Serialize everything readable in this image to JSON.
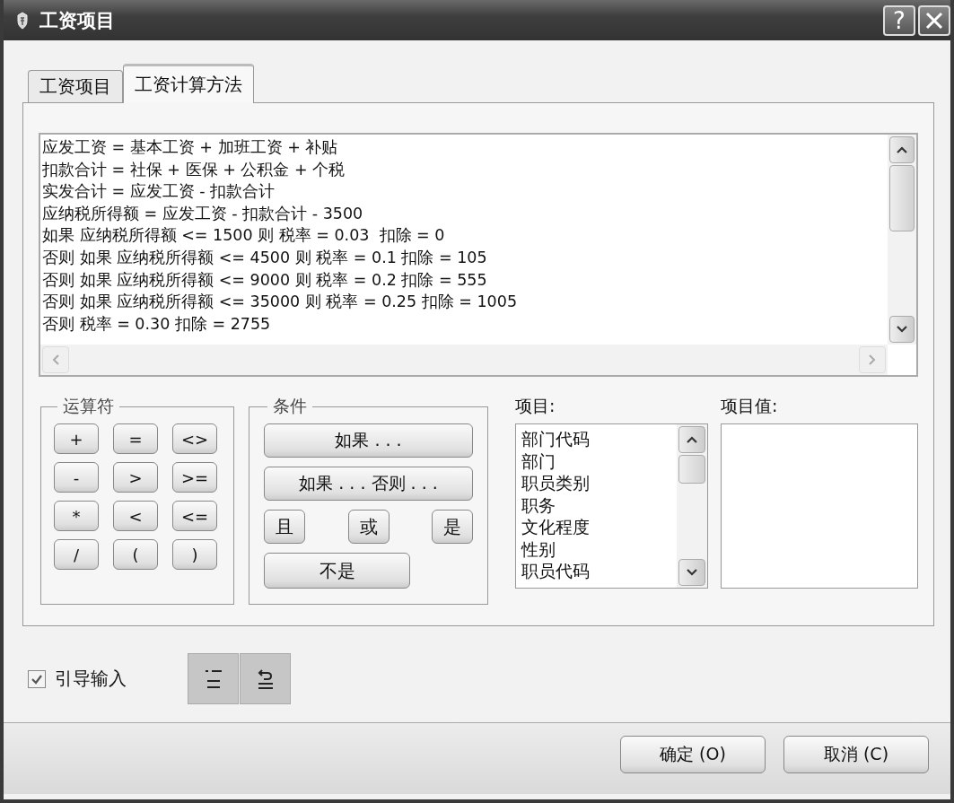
{
  "window": {
    "title": "工资项目",
    "help_button": "?"
  },
  "tabs": [
    {
      "label": "工资项目",
      "selected": false
    },
    {
      "label": "工资计算方法",
      "selected": true
    }
  ],
  "formula_lines": [
    "应发工资 = 基本工资 + 加班工资 + 补贴",
    "扣款合计 = 社保 + 医保 + 公积金 + 个税",
    "实发合计 = 应发工资 - 扣款合计",
    "应纳税所得额 = 应发工资 - 扣款合计 - 3500",
    "如果 应纳税所得额 <= 1500 则 税率 = 0.03  扣除 = 0",
    "否则 如果 应纳税所得额 <= 4500 则 税率 = 0.1 扣除 = 105",
    "否则 如果 应纳税所得额 <= 9000 则 税率 = 0.2 扣除 = 555",
    "否则 如果 应纳税所得额 <= 35000 则 税率 = 0.25 扣除 = 1005",
    "否则 税率 = 0.30 扣除 = 2755"
  ],
  "operators": {
    "title": "运算符",
    "buttons": [
      "+",
      "=",
      "<>",
      "-",
      ">",
      ">=",
      "*",
      "<",
      "<=",
      "/",
      "(",
      ")"
    ]
  },
  "conditions": {
    "title": "条件",
    "buttons": [
      {
        "label": "如果 . . .",
        "kind": "wide"
      },
      {
        "label": "如果 . . . 否则 . . .",
        "kind": "wide"
      },
      {
        "label": "且",
        "kind": "small"
      },
      {
        "label": "或",
        "kind": "small"
      },
      {
        "label": "是",
        "kind": "small"
      },
      {
        "label": "不是",
        "kind": "medium"
      }
    ]
  },
  "items": {
    "label": "项目:",
    "entries": [
      "部门代码",
      "部门",
      "职员类别",
      "职务",
      "文化程度",
      "性别",
      "职员代码"
    ]
  },
  "item_values": {
    "label": "项目值:"
  },
  "guided_input": {
    "label": "引导输入",
    "checked": true
  },
  "buttons": [
    "确定 (O)",
    "取消 (C)"
  ]
}
